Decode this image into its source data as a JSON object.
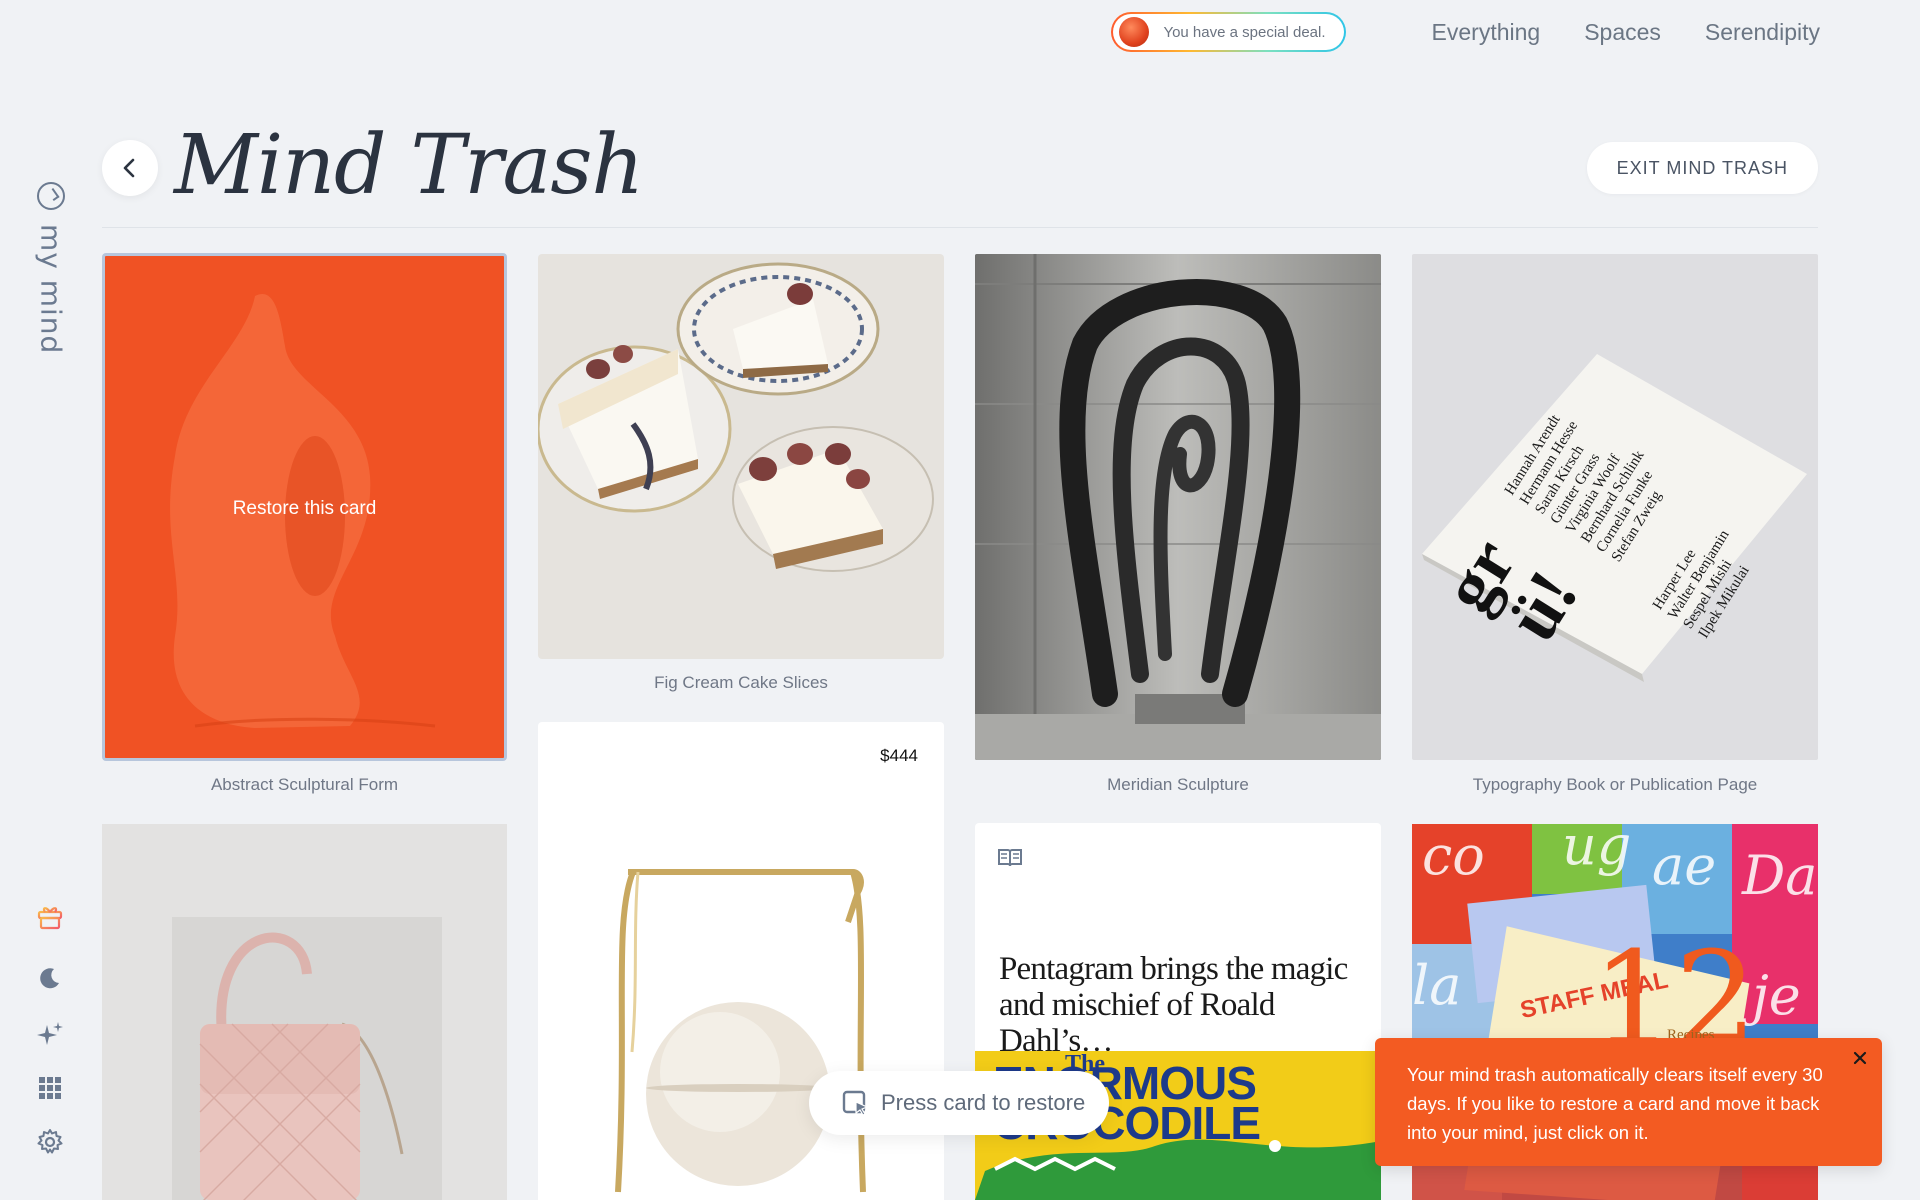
{
  "topnav": {
    "deal_text": "You have a special deal.",
    "links": [
      "Everything",
      "Spaces",
      "Serendipity"
    ]
  },
  "rail": {
    "brand": "my mind",
    "icons": [
      "gift-icon",
      "moon-icon",
      "sparkle-icon",
      "grid-icon",
      "gear-icon"
    ]
  },
  "header": {
    "title": "Mind Trash",
    "exit_label": "EXIT MIND TRASH"
  },
  "cards": [
    {
      "caption": "Abstract Sculptural Form",
      "overlay": "Restore this card"
    },
    {
      "caption": "Fig Cream Cake Slices"
    },
    {
      "caption": "Meridian Sculpture"
    },
    {
      "caption": "Typography Book or Publication Page"
    },
    {
      "caption": ""
    },
    {
      "price": "$444"
    },
    {
      "title": "Pentagram brings the magic and mischief of Roald Dahl’s…",
      "book_the": "The",
      "book_title": "ENORMOUS CROCODILE"
    },
    {
      "staff": "STAFF MEAL",
      "number": "12",
      "recipes": "Recipes"
    }
  ],
  "press_hint": "Press card to restore",
  "toast": {
    "text": "Your mind trash automatically clears itself every 30 days. If you like to restore a card and move it back into your mind, just click on it."
  },
  "colors": {
    "background": "#f0f2f5",
    "accent_orange": "#f35b22",
    "icon_gray": "#6b7a90"
  }
}
